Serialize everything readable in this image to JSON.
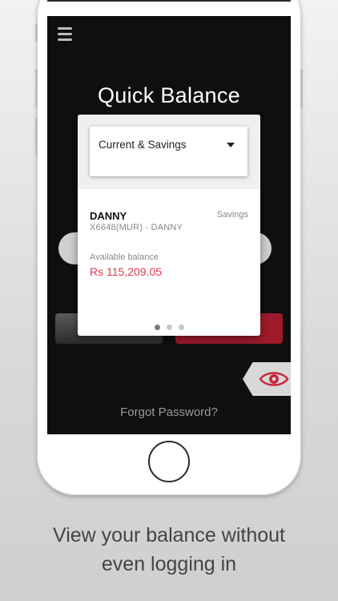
{
  "screen": {
    "title": "Quick Balance",
    "forgot_password": "Forgot Password?"
  },
  "card": {
    "account_selector": "Current & Savings",
    "account_name": "DANNY",
    "account_type": "Savings",
    "account_number": "X6648(MUR) - DANNY",
    "available_label": "Available balance",
    "available_value": "Rs 115,209.05",
    "page_dots": 3,
    "active_dot": 1
  },
  "caption": {
    "line1": "View your balance without",
    "line2": "even logging in"
  },
  "colors": {
    "accent_red": "#e0384f",
    "button_red": "#9e1a2b",
    "screen_bg": "#0f0f0f"
  },
  "icons": {
    "menu": "hamburger-menu-icon",
    "eye": "eye-icon",
    "dropdown": "chevron-down-icon"
  }
}
